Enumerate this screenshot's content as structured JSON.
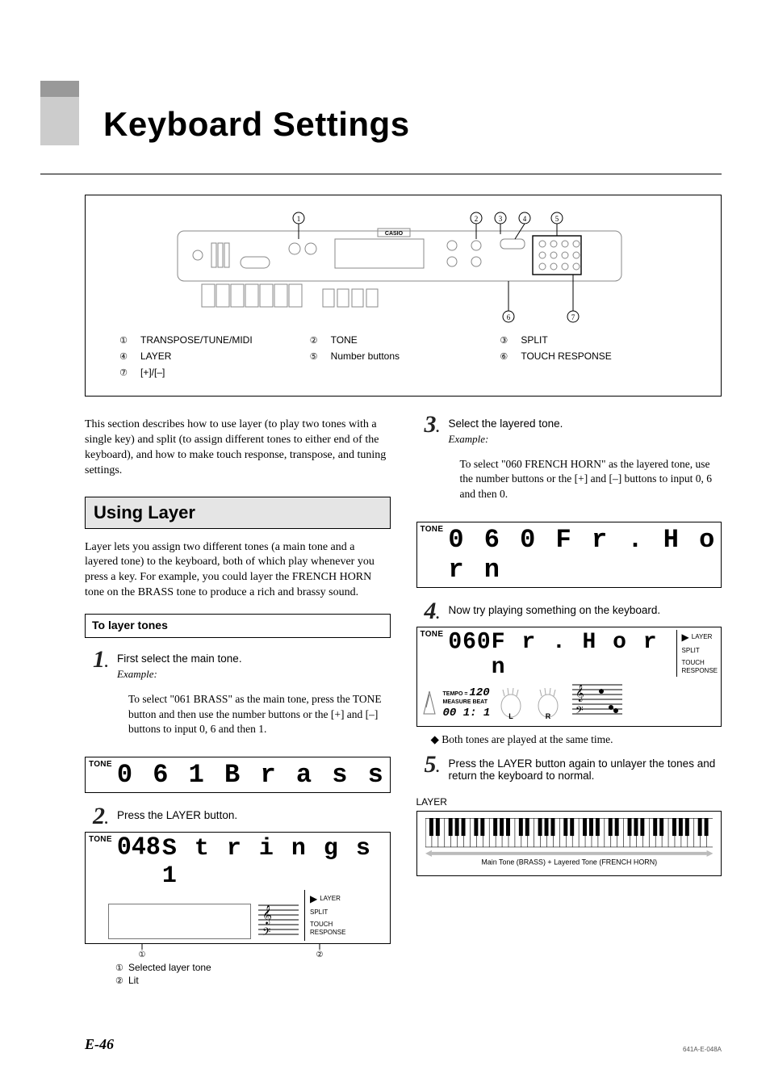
{
  "title": "Keyboard Settings",
  "legend": {
    "i1": "TRANSPOSE/TUNE/MIDI",
    "i2": "TONE",
    "i3": "SPLIT",
    "i4": "LAYER",
    "i5": "Number buttons",
    "i6": "TOUCH RESPONSE",
    "i7": "[+]/[–]"
  },
  "intro": "This section describes how to use layer (to play two tones with a single key) and split (to assign different tones to either end of the keyboard), and how to make touch response, transpose, and tuning settings.",
  "using_layer": {
    "heading": "Using Layer",
    "body": "Layer lets you assign two different tones (a main tone and a layered tone) to the keyboard, both of which play whenever you press a key. For example, you could layer the FRENCH HORN tone on the BRASS tone to produce a rich and brassy sound.",
    "sub": "To layer tones"
  },
  "steps": {
    "s1": {
      "lead": "First select the main tone.",
      "example_label": "Example:",
      "example": "To select \"061 BRASS\" as the main tone, press the TONE button and then use the number buttons or the [+] and [–] buttons to input 0, 6 and then 1."
    },
    "s2": {
      "lead": "Press the LAYER button."
    },
    "s3": {
      "lead": "Select the layered tone.",
      "example_label": "Example:",
      "example": "To select \"060 FRENCH HORN\" as the layered tone, use the number buttons or the [+] and [–] buttons to input 0, 6 and then 0."
    },
    "s4": {
      "lead": "Now try playing something on the keyboard.",
      "bullet": "Both tones are played at the same time."
    },
    "s5": {
      "lead": "Press the LAYER button again to unlayer the tones and return the keyboard to normal."
    }
  },
  "lcd": {
    "tone_label": "TONE",
    "r1": "0 6 1 B r a s s",
    "r2_num": "048",
    "r2_txt": "S t r i n g s 1",
    "r3": "0 6 0  F r . H o r n",
    "r4_num": "060",
    "r4_txt": "F r . H o r n",
    "tempo_lbl": "TEMPO =",
    "tempo_val": "120",
    "mb_lbl": "MEASURE BEAT",
    "mb_val": "00 1: 1",
    "hand_l": "L",
    "hand_r": "R",
    "ind_layer": "LAYER",
    "ind_split": "SPLIT",
    "ind_tr": "TOUCH\nRESPONSE"
  },
  "mini_legend": {
    "m1": "Selected layer tone",
    "m2": "Lit"
  },
  "layer_word": "LAYER",
  "kb_caption": "Main Tone (BRASS) + Layered Tone (FRENCH HORN)",
  "footer": {
    "page": "E-46",
    "code": "641A-E-048A"
  },
  "circ": {
    "c1": "①",
    "c2": "②",
    "c3": "③",
    "c4": "④",
    "c5": "⑤",
    "c6": "⑥",
    "c7": "⑦"
  },
  "kb_small_labels": {
    "casio": "CASIO"
  }
}
